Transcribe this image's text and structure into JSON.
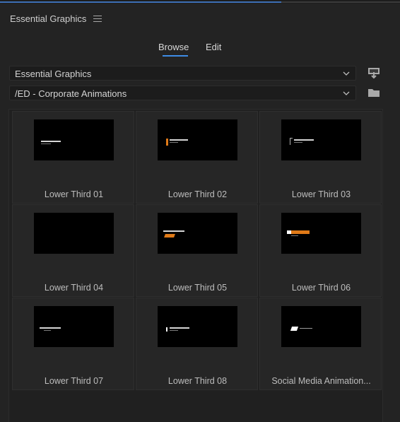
{
  "panel": {
    "title": "Essential Graphics"
  },
  "tabs": [
    {
      "label": "Browse",
      "active": true
    },
    {
      "label": "Edit",
      "active": false
    }
  ],
  "library_dropdown": {
    "value": "Essential Graphics"
  },
  "folder_dropdown": {
    "value": "/ED - Corporate Animations"
  },
  "templates": [
    {
      "label": "Lower Third 01"
    },
    {
      "label": "Lower Third 02"
    },
    {
      "label": "Lower Third 03"
    },
    {
      "label": "Lower Third 04"
    },
    {
      "label": "Lower Third 05"
    },
    {
      "label": "Lower Third 06"
    },
    {
      "label": "Lower Third 07"
    },
    {
      "label": "Lower Third 08"
    },
    {
      "label": "Social Media Animation..."
    }
  ],
  "colors": {
    "accent": "#3e8ce6",
    "thumb_orange": "#e07a18",
    "background": "#232323"
  },
  "icons": [
    "menu-icon",
    "chevron-down-icon",
    "install-template-icon",
    "folder-icon"
  ]
}
